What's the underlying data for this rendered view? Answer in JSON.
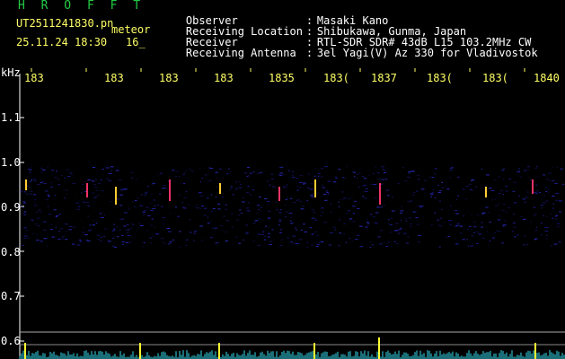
{
  "header": {
    "station_code": "H R O F F T",
    "file_name": "UT2511241830.pn",
    "mode_label": "meteor",
    "datetime": "25.11.24 18:30",
    "extra_val": "16_",
    "info": [
      {
        "label": "Observer",
        "value": "Masaki Kano"
      },
      {
        "label": "Receiving Location",
        "value": "Shibukawa, Gunma, Japan"
      },
      {
        "label": "Receiver",
        "value": "RTL-SDR SDR# 43dB L15 103.2MHz CW"
      },
      {
        "label": "Receiving Antenna",
        "value": "3el Yagi(V) Az 330 for Vladivostok"
      }
    ]
  },
  "axis": {
    "y_unit": "kHz",
    "y_ticks": [
      "1.1",
      "1.0",
      "0.9",
      "0.8",
      "0.7",
      "0.6"
    ],
    "x_ticks": [
      "183",
      "183",
      "183",
      "183",
      "1835",
      "183(",
      "1837",
      "183(",
      "183(",
      "1840"
    ]
  },
  "colors": {
    "header_green": "#22cc44",
    "header_yellow": "#ffff66",
    "trace_cyan": "#33ddee",
    "trace_yellow": "#ffff33"
  }
}
